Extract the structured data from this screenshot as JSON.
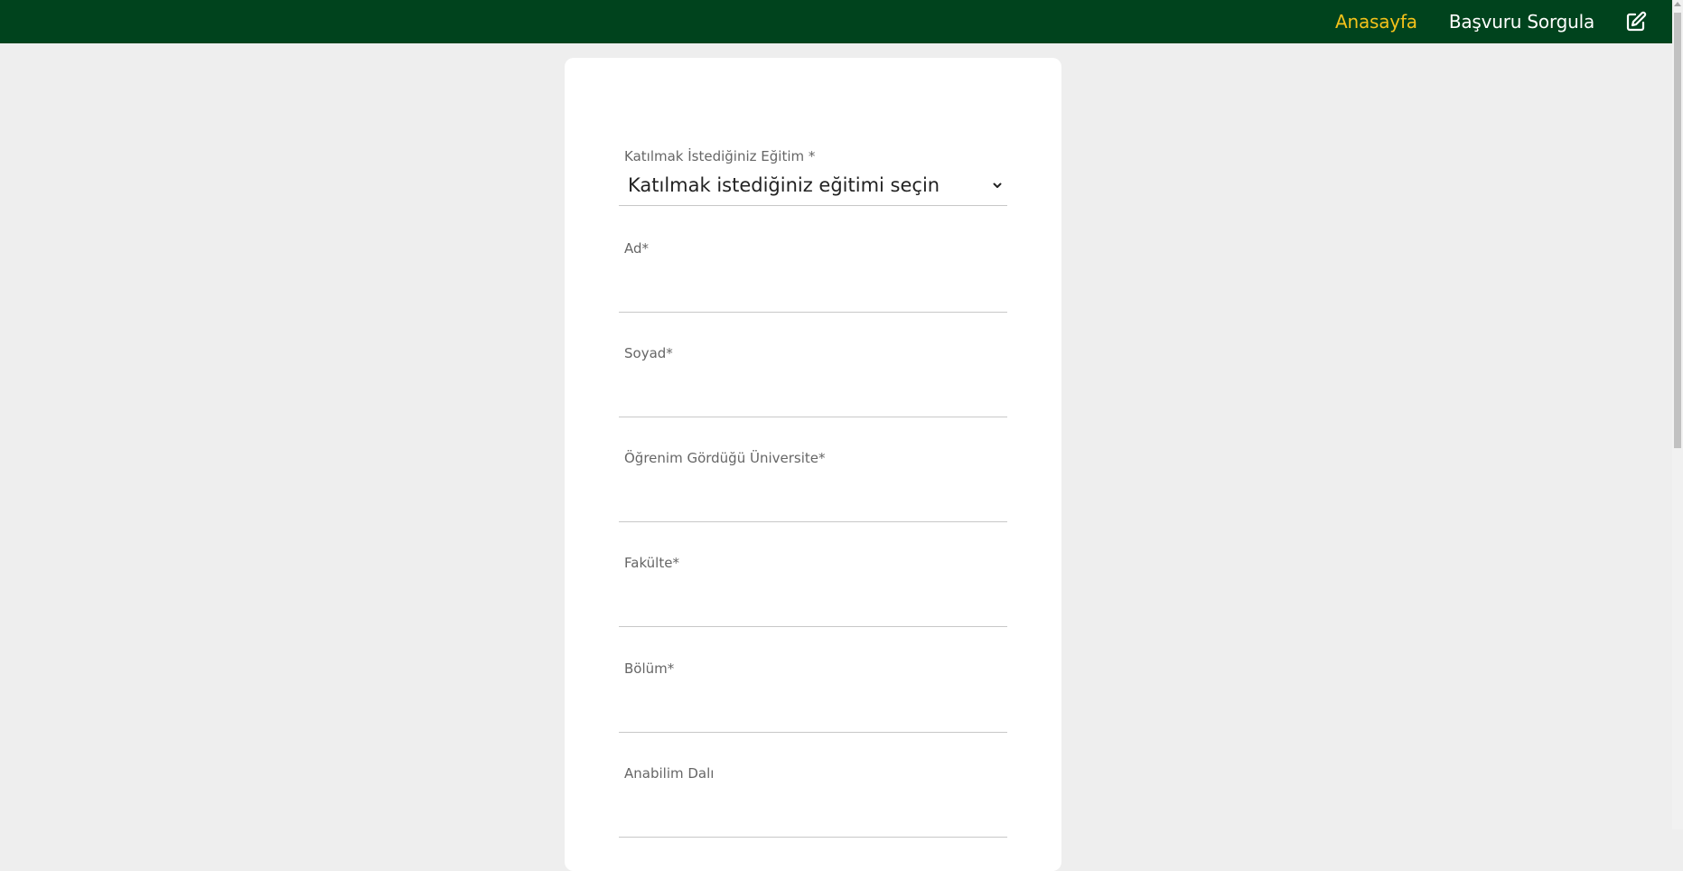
{
  "nav": {
    "home_label": "Anasayfa",
    "query_label": "Başvuru Sorgula",
    "edit_icon": "edit-square-icon",
    "active_color": "#f4c21a",
    "bar_color": "#00431d"
  },
  "form": {
    "training": {
      "label": "Katılmak İstediğiniz Eğitim *",
      "selected": "Katılmak istediğiniz eğitimi seçin"
    },
    "first_name": {
      "label": "Ad*",
      "value": ""
    },
    "last_name": {
      "label": "Soyad*",
      "value": ""
    },
    "university": {
      "label": "Öğrenim Gördüğü Üniversite*",
      "value": ""
    },
    "faculty": {
      "label": "Fakülte*",
      "value": ""
    },
    "department": {
      "label": "Bölüm*",
      "value": ""
    },
    "major_field": {
      "label": "Anabilim Dalı",
      "value": ""
    }
  }
}
